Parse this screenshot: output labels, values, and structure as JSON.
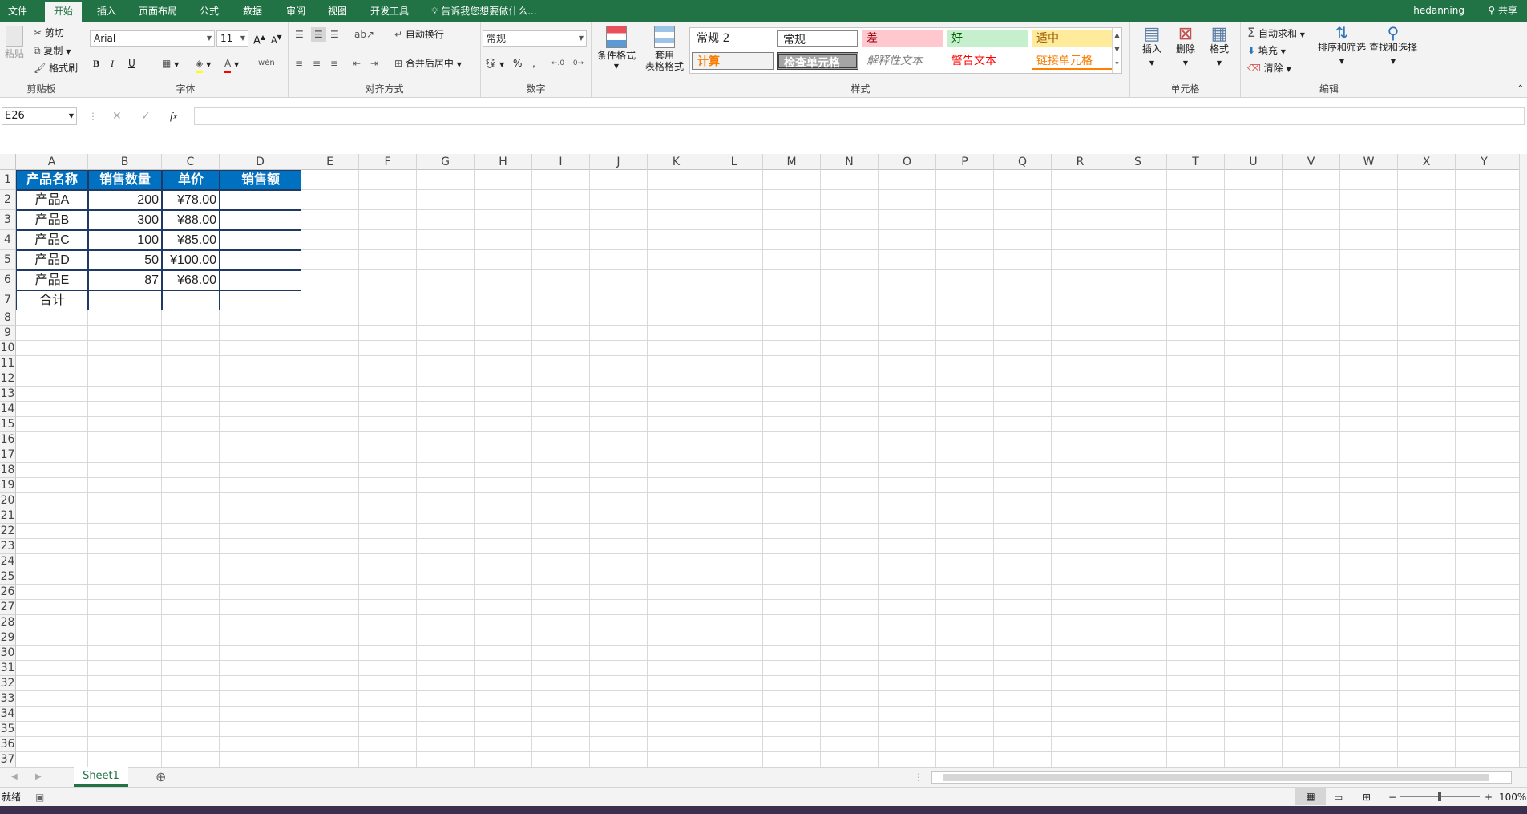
{
  "ribbon_tabs": {
    "file": "文件",
    "home": "开始",
    "insert": "插入",
    "layout": "页面布局",
    "formulas": "公式",
    "data": "数据",
    "review": "审阅",
    "view": "视图",
    "developer": "开发工具"
  },
  "tell_me": "告诉我您想要做什么...",
  "user": "hedanning",
  "share": "共享",
  "clipboard": {
    "paste": "粘贴",
    "cut": "剪切",
    "copy": "复制",
    "format_painter": "格式刷",
    "label": "剪贴板"
  },
  "font": {
    "name": "Arial",
    "size": "11",
    "label": "字体"
  },
  "alignment": {
    "wrap": "自动换行",
    "merge": "合并后居中",
    "label": "对齐方式"
  },
  "number": {
    "format": "常规",
    "label": "数字"
  },
  "styles": {
    "cond": "条件格式",
    "table1": "套用",
    "table2": "表格格式",
    "label": "样式",
    "items": {
      "normal2": "常规 2",
      "normal": "常规",
      "bad": "差",
      "good": "好",
      "neutral": "适中",
      "calc": "计算",
      "check": "检查单元格",
      "explain": "解释性文本",
      "warn": "警告文本",
      "link": "链接单元格"
    }
  },
  "cells": {
    "insert": "插入",
    "delete": "删除",
    "format": "格式",
    "label": "单元格"
  },
  "editing": {
    "autosum": "自动求和",
    "fill": "填充",
    "clear": "清除",
    "sort": "排序和筛选",
    "find": "查找和选择",
    "label": "编辑"
  },
  "name_box": "E26",
  "fx": "fx",
  "columns": [
    "A",
    "B",
    "C",
    "D",
    "E",
    "F",
    "G",
    "H",
    "I",
    "J",
    "K",
    "L",
    "M",
    "N",
    "O",
    "P",
    "Q",
    "R",
    "S",
    "T",
    "U",
    "V",
    "W",
    "X",
    "Y"
  ],
  "rows": [
    "1",
    "2",
    "3",
    "4",
    "5",
    "6",
    "7",
    "8",
    "9",
    "10",
    "11",
    "12",
    "13",
    "14",
    "15",
    "16",
    "17",
    "18",
    "19",
    "20",
    "21",
    "22",
    "23",
    "24",
    "25",
    "26",
    "27",
    "28",
    "29",
    "30",
    "31",
    "32",
    "33",
    "34",
    "35",
    "36",
    "37"
  ],
  "table": {
    "headers": [
      "产品名称",
      "销售数量",
      "单价",
      "销售额"
    ],
    "data": [
      [
        "产品A",
        "200",
        "¥78.00",
        ""
      ],
      [
        "产品B",
        "300",
        "¥88.00",
        ""
      ],
      [
        "产品C",
        "100",
        "¥85.00",
        ""
      ],
      [
        "产品D",
        "50",
        "¥100.00",
        ""
      ],
      [
        "产品E",
        "87",
        "¥68.00",
        ""
      ]
    ],
    "total": "合计"
  },
  "sheet_tab": "Sheet1",
  "status": "就绪",
  "zoom": "100%",
  "colors": {
    "accent": "#217346",
    "header_fill": "#0070c0"
  }
}
